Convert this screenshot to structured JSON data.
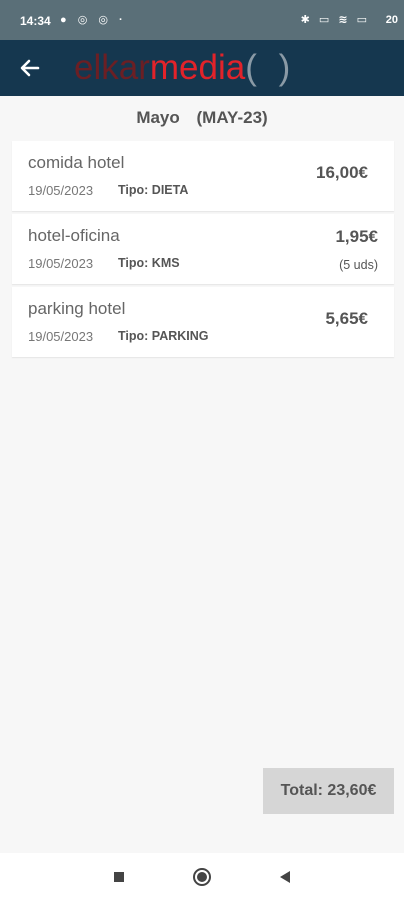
{
  "status": {
    "time": "14:34",
    "battery": "20"
  },
  "app": {
    "logo_a": "elkar",
    "logo_b": "media",
    "logo_c": "( )"
  },
  "period": {
    "month": "Mayo",
    "code": "(MAY-23)"
  },
  "items": [
    {
      "concept": "comida hotel",
      "date": "19/05/2023",
      "tipo": "Tipo: DIETA",
      "amount": "16,00€",
      "units": ""
    },
    {
      "concept": "hotel-oficina",
      "date": "19/05/2023",
      "tipo": "Tipo: KMS",
      "amount": "1,95€",
      "units": "(5 uds)"
    },
    {
      "concept": "parking hotel",
      "date": "19/05/2023",
      "tipo": "Tipo: PARKING",
      "amount": "5,65€",
      "units": ""
    }
  ],
  "total": "Total: 23,60€",
  "icons": {
    "back": "arrow-left-icon",
    "nav_recents": "square-icon",
    "nav_home": "circle-icon",
    "nav_back": "triangle-back-icon"
  },
  "colors": {
    "app_bar": "#15374f",
    "status_bar": "#5a6f78",
    "logo_red": "#e2232a",
    "background": "#f7f7f7"
  }
}
